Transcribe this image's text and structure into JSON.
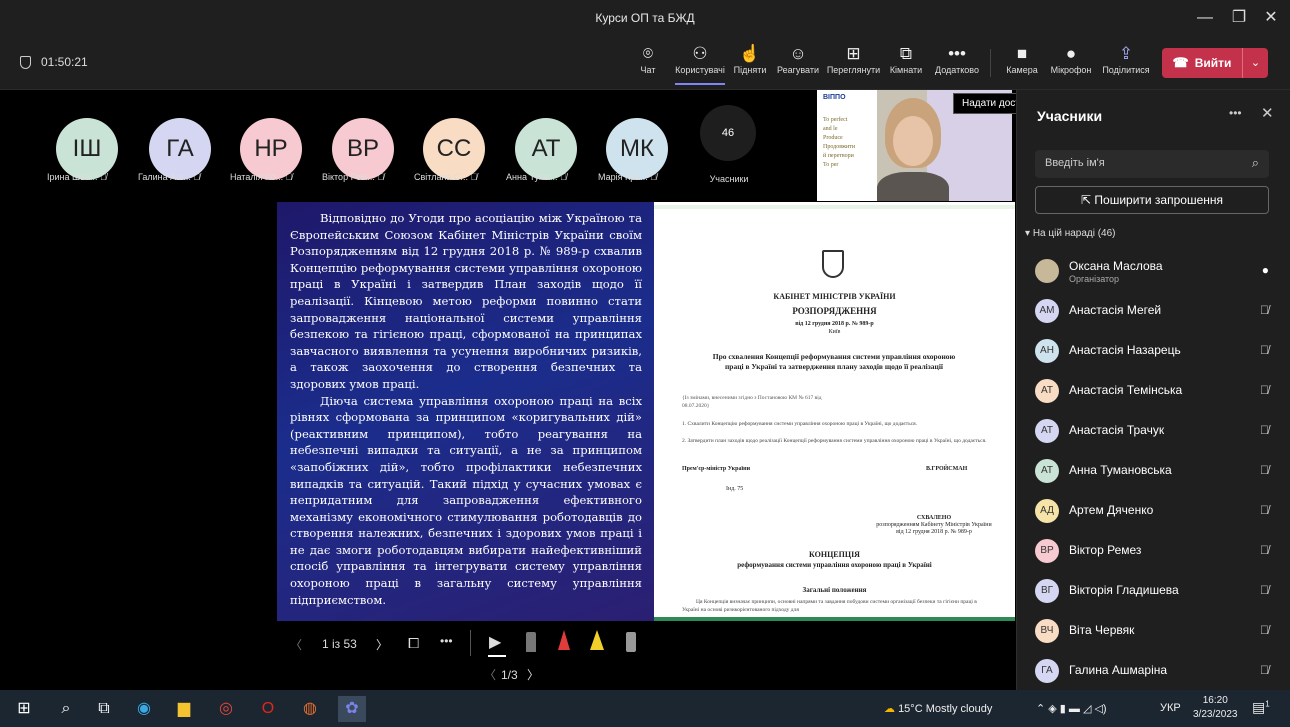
{
  "window": {
    "title": "Курси ОП та БЖД",
    "minimize": "—",
    "restore": "❐",
    "close": "✕"
  },
  "toolbar": {
    "timer": "01:50:21",
    "buttons": [
      {
        "label": "Чат",
        "icon": "chat-icon",
        "glyph": "💬"
      },
      {
        "label": "Користувачі",
        "icon": "people-icon",
        "glyph": "👥"
      },
      {
        "label": "Підняти",
        "icon": "raise-hand-icon",
        "glyph": "✋"
      },
      {
        "label": "Реагувати",
        "icon": "react-icon",
        "glyph": "☺"
      },
      {
        "label": "Переглянути",
        "icon": "view-icon",
        "glyph": "⊞"
      },
      {
        "label": "Кімнати",
        "icon": "rooms-icon",
        "glyph": "⧉"
      },
      {
        "label": "Додатково",
        "icon": "more-icon",
        "glyph": "•••"
      },
      {
        "label": "Камера",
        "icon": "camera-icon",
        "glyph": "■"
      },
      {
        "label": "Мікрофон",
        "icon": "mic-icon",
        "glyph": "🎤"
      },
      {
        "label": "Поділитися",
        "icon": "share-icon",
        "glyph": "⇪"
      }
    ],
    "leave_label": "Вийти",
    "leave_caret": "⌄",
    "tooltip": "Надати доступ до вмісту (Ctrl+Shift+E)"
  },
  "participants_row": [
    {
      "initials": "ІШ",
      "name": "Ірина Шва...",
      "color": "#c9e4d6"
    },
    {
      "initials": "ГА",
      "name": "Галина Аш...",
      "color": "#d5d7f2"
    },
    {
      "initials": "НР",
      "name": "Наталія Ро...",
      "color": "#f7c9d0"
    },
    {
      "initials": "ВР",
      "name": "Віктор Рем...",
      "color": "#f7c9d0"
    },
    {
      "initials": "СС",
      "name": "Світлана С...",
      "color": "#f8dcc4"
    },
    {
      "initials": "АТ",
      "name": "Анна Тума...",
      "color": "#c9e4d6"
    },
    {
      "initials": "МК",
      "name": "Марія Кри...",
      "color": "#cfe3ee"
    }
  ],
  "more": {
    "count": "46",
    "label": "Учасники"
  },
  "video": {
    "logo": "ВІППО",
    "lines": [
      "To perfect",
      "and le",
      "Produce",
      "Продовжити",
      "й перетвори",
      "To per"
    ]
  },
  "slide": {
    "paragraph1": "Відповідно до Угоди про асоціацію між Україною та Європейським Союзом Кабінет Міністрів України своїм Розпорядженням від 12 грудня 2018 р. № 989-р схвалив Концепцію реформування системи управління охороною праці в Україні і затвердив План заходів щодо її реалізації. Кінцевою метою реформи повинно стати запровадження національної системи управління безпекою та гігієною праці, сформованої на принципах завчасного виявлення та усунення виробничих ризиків, а також заохочення до створення безпечних та здорових умов праці.",
    "paragraph2": "Діюча система управління охороною праці на всіх рівнях сформована за принципом «коригувальних дій» (реактивним принципом), тобто реагування на небезпечні випадки та ситуації, а не за принципом «запобіжних дій», тобто профілактики небезпечних випадків та ситуацій. Такий підхід у сучасних умовах є непридатним для запровадження ефективного механізму економічного стимулювання роботодавців до створення належних, безпечних і здорових умов праці і не дає змоги роботодавцям вибирати найефективніший спосіб управління та інтегрувати систему управління охороною праці в загальну систему управління підприємством.",
    "doc": {
      "org": "КАБІНЕТ МІНІСТРІВ УКРАЇНИ",
      "kind": "РОЗПОРЯДЖЕННЯ",
      "date": "від 12 грудня 2018 р. № 989-р",
      "city": "Київ",
      "subject": "Про схвалення Концепції реформування системи управління охороною праці в Україні та затвердження плану заходів щодо її реалізації",
      "amend": "{Із змінами, внесеними згідно з Постановою КМ № 617 від 08.07.2020}",
      "item1": "1. Схвалити Концепцію реформування системи управління охороною праці в Україні, що додається.",
      "item2": "2. Затвердити план заходів щодо реалізації Концепції реформування системи управління охороною праці в Україні, що додається.",
      "signer_title": "Прем'єр-міністр України",
      "signer": "В.ГРОЙСМАН",
      "index": "Інд. 75",
      "approved": "СХВАЛЕНО",
      "approved_by": "розпорядженням Кабінету Міністрів України",
      "approved_date": "від 12 грудня 2018 р. № 989-р",
      "concept_title": "КОНЦЕПЦІЯ",
      "concept_sub": "реформування системи управління охороною праці в Україні",
      "general": "Загальні положення",
      "general_text": "Ця Концепція визначає принципи, основні напрями та завдання побудови системи організації безпеки та гігієни праці в Україні на основі ризикорієнтованого підходу для"
    }
  },
  "controls": {
    "page": "1 із 53",
    "sub_page": "1/3",
    "prev": "〈",
    "next": "〉",
    "more": "•••"
  },
  "panel": {
    "title": "Учасники",
    "search_placeholder": "Введіть ім'я",
    "invite": "Поширити запрошення",
    "section": "На цій нараді (46)",
    "people": [
      {
        "initials": "",
        "name": "Оксана Маслова",
        "role": "Організатор",
        "color": "#c8b89a",
        "mic": "🎤"
      },
      {
        "initials": "АМ",
        "name": "Анастасія Мегей",
        "role": "",
        "color": "#d5d7f2",
        "mic": "🎙̸"
      },
      {
        "initials": "АН",
        "name": "Анастасія Назарець",
        "role": "",
        "color": "#cfe3ee",
        "mic": "🎙̸"
      },
      {
        "initials": "АТ",
        "name": "Анастасія Темінська",
        "role": "",
        "color": "#f8dcc4",
        "mic": "🎙̸"
      },
      {
        "initials": "АТ",
        "name": "Анастасія Трачук",
        "role": "",
        "color": "#d5d7f2",
        "mic": "🎙̸"
      },
      {
        "initials": "АТ",
        "name": "Анна Тумановська",
        "role": "",
        "color": "#c9e4d6",
        "mic": "🎙̸"
      },
      {
        "initials": "АД",
        "name": "Артем Дяченко",
        "role": "",
        "color": "#f5e3a8",
        "mic": "🎙̸"
      },
      {
        "initials": "ВР",
        "name": "Віктор Ремез",
        "role": "",
        "color": "#f7c9d0",
        "mic": "🎙̸"
      },
      {
        "initials": "ВГ",
        "name": "Вікторія Гладишева",
        "role": "",
        "color": "#d5d7f2",
        "mic": "🎙̸"
      },
      {
        "initials": "ВЧ",
        "name": "Віта Червяк",
        "role": "",
        "color": "#f8dcc4",
        "mic": "🎙̸"
      },
      {
        "initials": "ГА",
        "name": "Галина Ашмаріна",
        "role": "",
        "color": "#d5d7f2",
        "mic": "🎙̸"
      }
    ]
  },
  "taskbar": {
    "weather": "15°C  Mostly cloudy",
    "lang": "УКР",
    "time": "16:20",
    "date": "3/23/2023",
    "notif": "1"
  }
}
